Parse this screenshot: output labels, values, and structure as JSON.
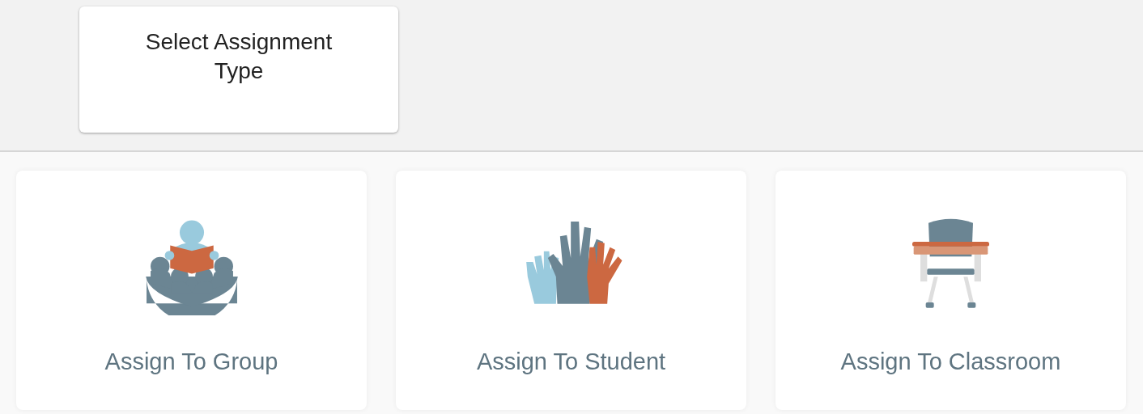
{
  "header": {
    "title": "Select Assignment Type"
  },
  "options": [
    {
      "kind": "group",
      "label": "Assign To Group"
    },
    {
      "kind": "student",
      "label": "Assign To Student"
    },
    {
      "kind": "classroom",
      "label": "Assign To Classroom"
    }
  ]
}
